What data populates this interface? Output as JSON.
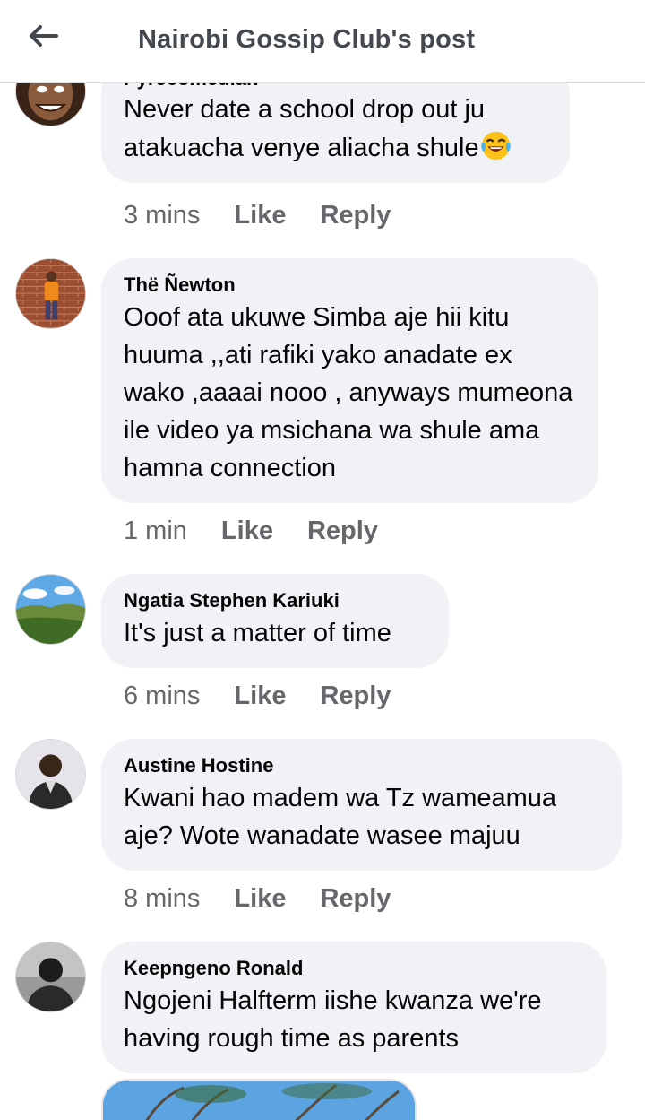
{
  "header": {
    "title": "Nairobi Gossip Club's post",
    "back_icon": "arrow-left-icon"
  },
  "comments": [
    {
      "author": "Pyrecomedian",
      "text": "Never date a school drop out ju atakuacha venye aliacha shule",
      "emoji": "tears-of-joy-emoji",
      "time": "3 mins",
      "like": "Like",
      "reply": "Reply"
    },
    {
      "author": "Thë Ñewton",
      "text": "Ooof ata ukuwe Simba aje hii kitu huuma ,,ati rafiki yako anadate ex wako ,aaaai nooo , anyways mumeona ile video ya msichana wa shule ama hamna connection",
      "time": "1 min",
      "like": "Like",
      "reply": "Reply"
    },
    {
      "author": "Ngatia Stephen Kariuki",
      "text": "It's just a matter of time",
      "time": "6 mins",
      "like": "Like",
      "reply": "Reply"
    },
    {
      "author": "Austine Hostine",
      "text": "Kwani hao madem wa Tz wameamua aje? Wote wanadate wasee majuu",
      "time": "8 mins",
      "like": "Like",
      "reply": "Reply"
    },
    {
      "author": "Keepngeno Ronald",
      "text": "Ngojeni Halfterm iishe kwanza we're having rough time as parents",
      "time": "",
      "like": "",
      "reply": ""
    }
  ],
  "colors": {
    "bubble": "#f0f2f5",
    "meta": "#65676b",
    "title": "#444950"
  }
}
